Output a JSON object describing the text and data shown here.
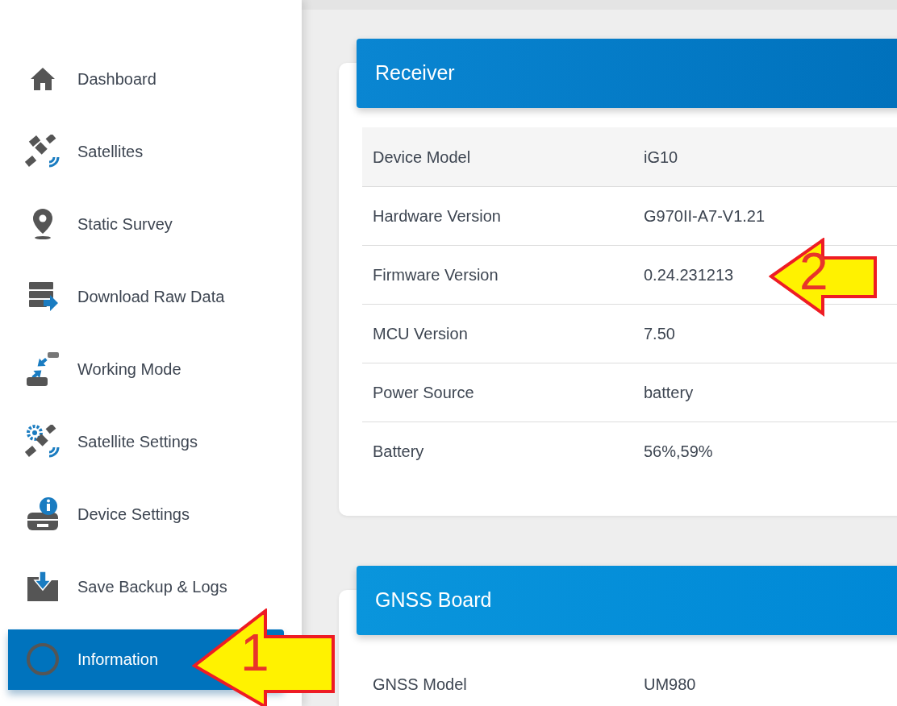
{
  "sidebar": {
    "items": [
      {
        "label": "Dashboard",
        "selected": false
      },
      {
        "label": "Satellites",
        "selected": false
      },
      {
        "label": "Static Survey",
        "selected": false
      },
      {
        "label": "Download Raw Data",
        "selected": false
      },
      {
        "label": "Working Mode",
        "selected": false
      },
      {
        "label": "Satellite Settings",
        "selected": false
      },
      {
        "label": "Device Settings",
        "selected": false
      },
      {
        "label": "Save Backup & Logs",
        "selected": false
      },
      {
        "label": "Information",
        "selected": true
      }
    ]
  },
  "cards": [
    {
      "title": "Receiver",
      "rows": [
        {
          "label": "Device Model",
          "value": "iG10"
        },
        {
          "label": "Hardware Version",
          "value": "G970II-A7-V1.21"
        },
        {
          "label": "Firmware Version",
          "value": "0.24.231213"
        },
        {
          "label": "MCU Version",
          "value": "7.50"
        },
        {
          "label": "Power Source",
          "value": "battery"
        },
        {
          "label": "Battery",
          "value": "56%,59%"
        }
      ]
    },
    {
      "title": "GNSS Board",
      "rows": [
        {
          "label": "GNSS Model",
          "value": "UM980"
        }
      ]
    }
  ],
  "annotations": [
    {
      "label": "1"
    },
    {
      "label": "2"
    }
  ]
}
